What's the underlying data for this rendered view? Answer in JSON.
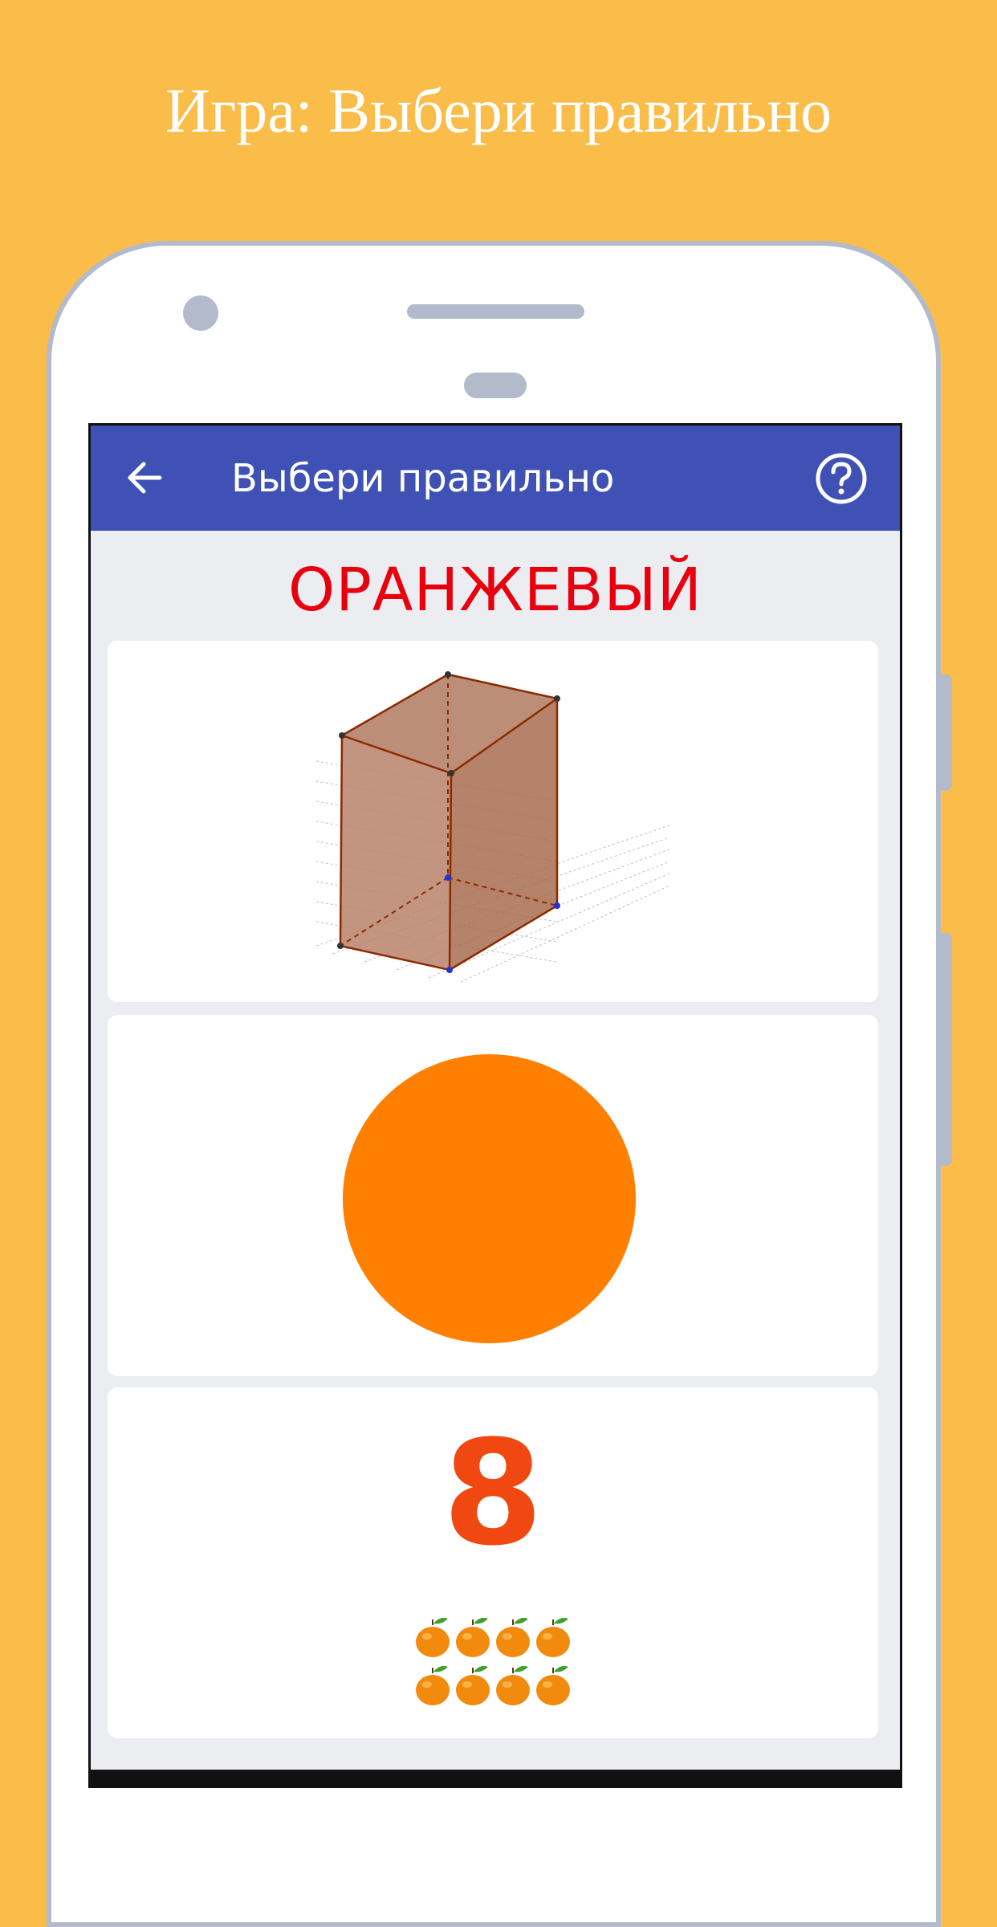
{
  "promo": {
    "title": "Игра: Выбери правильно"
  },
  "appbar": {
    "title": "Выбери правильно",
    "back_icon": "arrow-left-icon",
    "help_icon": "help-circle-icon",
    "color": "#3F51B5"
  },
  "game": {
    "prompt": "ОРАНЖЕВЫЙ",
    "prompt_color": "#E8000F",
    "options": [
      {
        "kind": "image",
        "content": "cube",
        "fill_color": "#B07A60",
        "edge_color": "#8B2A00"
      },
      {
        "kind": "shape",
        "content": "circle",
        "fill_color": "#FF8000"
      },
      {
        "kind": "number",
        "value": "8",
        "value_color": "#F04810",
        "item_icon": "tangerine-icon",
        "item_count": 8
      }
    ]
  },
  "colors": {
    "background": "#FBBD4A",
    "phone_frame": "#B2BACB",
    "screen_bg": "#EBEDF1"
  }
}
